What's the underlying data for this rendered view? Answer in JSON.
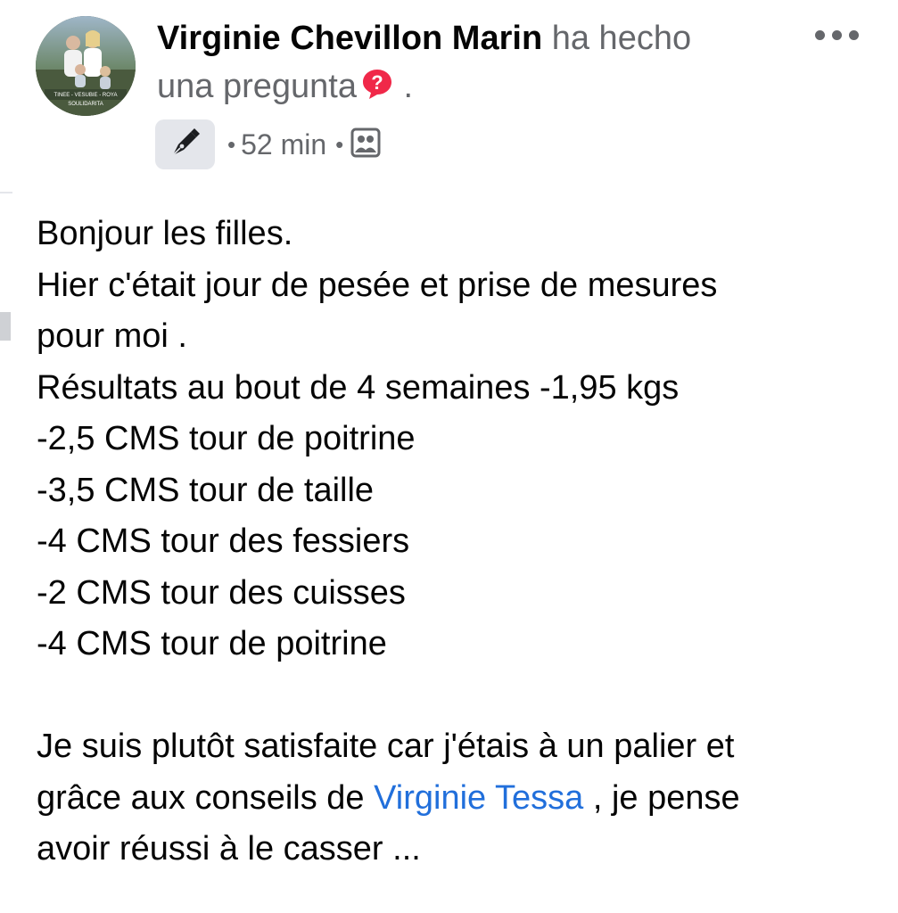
{
  "post": {
    "author": "Virginie Chevillon Marin",
    "action_part1": "ha hecho",
    "action_part2": "una pregunta",
    "action_end": ".",
    "question_icon": "question-badge-icon",
    "avatar_text": "TINEE - VESUBIE - ROYA SOULIDARITA",
    "meta": {
      "badge_icon": "pen-nib-icon",
      "separator": "•",
      "time": "52 min",
      "audience_icon": "group-icon"
    },
    "more_icon": "more-options-icon",
    "colors": {
      "text": "#050505",
      "secondary": "#65676b",
      "mention": "#216fdb",
      "question_badge": "#f02849",
      "badge_bg": "#e4e6eb"
    },
    "body": {
      "lines": [
        "Bonjour les filles.",
        "Hier c'était jour de pesée et prise de mesures",
        "pour moi .",
        "Résultats au bout de 4 semaines -1,95 kgs",
        "-2,5 CMS tour de poitrine",
        "-3,5 CMS tour de taille",
        "-4 CMS tour des fessiers",
        "-2 CMS tour des cuisses",
        "-4 CMS tour de poitrine"
      ],
      "para2_line1": "Je suis plutôt satisfaite car j'étais à un palier et",
      "para2_line2_before": "grâce aux conseils de ",
      "mention": "Virginie Tessa",
      "para2_line2_after": " , je pense",
      "para2_line3": "avoir réussi à le casser ..."
    }
  }
}
